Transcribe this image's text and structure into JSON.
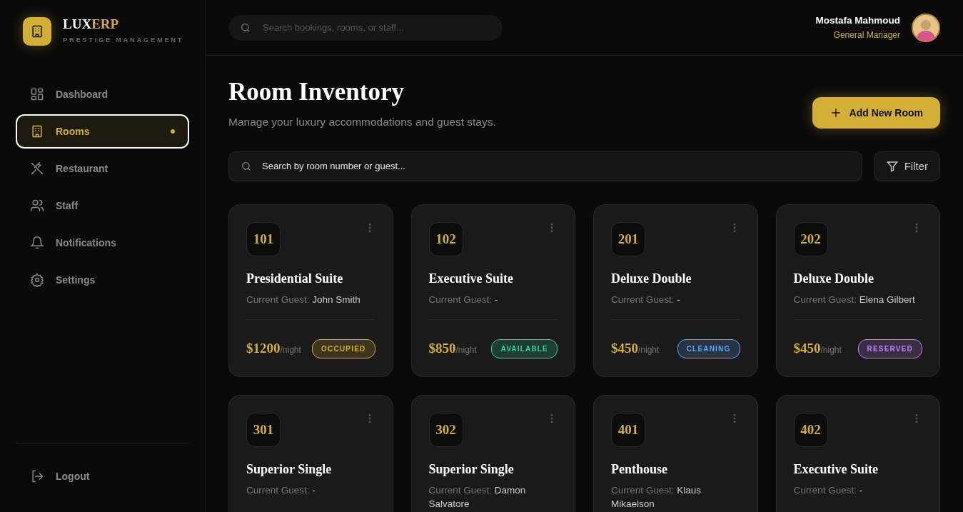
{
  "brand": {
    "name_part1": "LUX",
    "name_part2": "ERP",
    "tagline": "PRESTIGE MANAGEMENT"
  },
  "sidebar": {
    "items": [
      {
        "label": "Dashboard",
        "selected": false
      },
      {
        "label": "Rooms",
        "selected": true
      },
      {
        "label": "Restaurant",
        "selected": false
      },
      {
        "label": "Staff",
        "selected": false
      },
      {
        "label": "Notifications",
        "selected": false
      },
      {
        "label": "Settings",
        "selected": false
      }
    ],
    "logout": "Logout"
  },
  "topbar": {
    "search_placeholder": "Search bookings, rooms, or staff...",
    "user_name": "Mostafa Mahmoud",
    "user_role": "General Manager"
  },
  "page": {
    "title": "Room Inventory",
    "subtitle": "Manage your luxury accommodations and guest stays.",
    "add_button": "Add New Room",
    "search_placeholder": "Search by room number or guest...",
    "filter_button": "Filter"
  },
  "rooms": [
    {
      "number": "101",
      "name": "Presidential Suite",
      "guest_label": "Current Guest:",
      "guest": "John Smith",
      "price": "$1200",
      "unit": "/night",
      "status": "OCCUPIED",
      "color": "#d4af37"
    },
    {
      "number": "102",
      "name": "Executive Suite",
      "guest_label": "Current Guest:",
      "guest": "-",
      "price": "$850",
      "unit": "/night",
      "status": "AVAILABLE",
      "color": "#34d399"
    },
    {
      "number": "201",
      "name": "Deluxe Double",
      "guest_label": "Current Guest:",
      "guest": "-",
      "price": "$450",
      "unit": "/night",
      "status": "CLEANING",
      "color": "#60a5fa"
    },
    {
      "number": "202",
      "name": "Deluxe Double",
      "guest_label": "Current Guest:",
      "guest": "Elena Gilbert",
      "price": "$450",
      "unit": "/night",
      "status": "RESERVED",
      "color": "#c084fc"
    },
    {
      "number": "301",
      "name": "Superior Single",
      "guest_label": "Current Guest:",
      "guest": "-"
    },
    {
      "number": "302",
      "name": "Superior Single",
      "guest_label": "Current Guest:",
      "guest": "Damon Salvatore"
    },
    {
      "number": "401",
      "name": "Penthouse",
      "guest_label": "Current Guest:",
      "guest": "Klaus Mikaelson"
    },
    {
      "number": "402",
      "name": "Executive Suite",
      "guest_label": "Current Guest:",
      "guest": "-"
    }
  ]
}
